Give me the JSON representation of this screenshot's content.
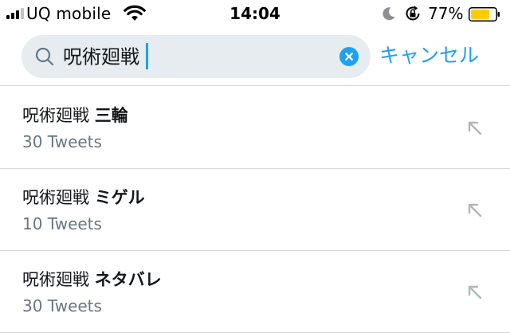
{
  "status_bar": {
    "carrier": "UQ mobile",
    "time": "14:04",
    "battery_percent": "77%",
    "battery_level": 0.77,
    "battery_color": "#ffcc00"
  },
  "search": {
    "query": "呪術廻戦",
    "cancel_label": "キャンセル",
    "accent_color": "#1da1f2"
  },
  "suggestions": [
    {
      "base": "呪術廻戦",
      "term": "三輪",
      "count": "30 Tweets"
    },
    {
      "base": "呪術廻戦",
      "term": "ミゲル",
      "count": "10 Tweets"
    },
    {
      "base": "呪術廻戦",
      "term": "ネタバレ",
      "count": "30 Tweets"
    }
  ]
}
